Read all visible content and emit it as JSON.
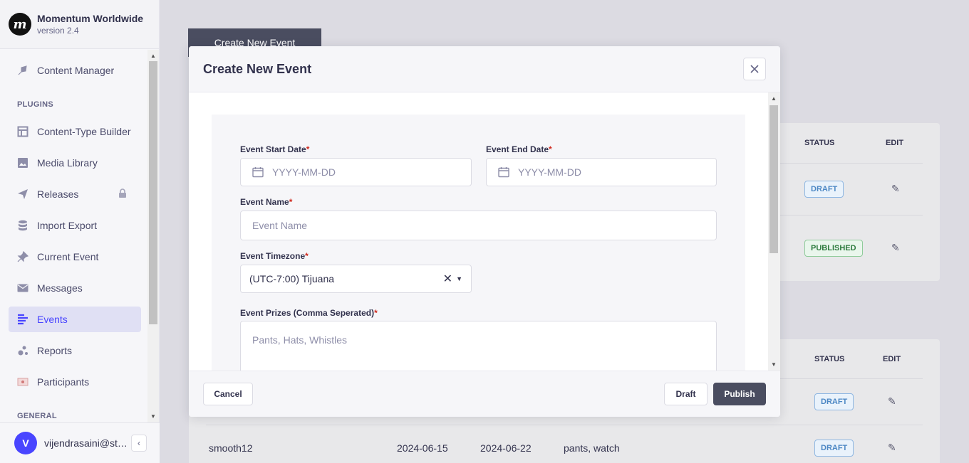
{
  "sidebar": {
    "brand_name": "Momentum Worldwide",
    "brand_version": "version 2.4",
    "items": [
      {
        "label": "Content Manager",
        "icon": "feather-icon"
      },
      {
        "label": "Content-Type Builder",
        "icon": "layout-icon"
      },
      {
        "label": "Media Library",
        "icon": "image-icon"
      },
      {
        "label": "Releases",
        "icon": "paper-plane-icon"
      },
      {
        "label": "Import Export",
        "icon": "database-icon"
      },
      {
        "label": "Current Event",
        "icon": "pin-icon"
      },
      {
        "label": "Messages",
        "icon": "envelope-icon"
      },
      {
        "label": "Events",
        "icon": "list-icon"
      },
      {
        "label": "Reports",
        "icon": "chart-dots-icon"
      },
      {
        "label": "Participants",
        "icon": "badge-icon"
      }
    ],
    "section_plugins": "PLUGINS",
    "section_general": "GENERAL",
    "user_initial": "V",
    "user_email": "vijendrasaini@stackfusion.io"
  },
  "background": {
    "create_button": "Create New Event",
    "table1": {
      "headers": [
        "STATUS",
        "EDIT"
      ],
      "rows": [
        {
          "status": "DRAFT"
        },
        {
          "status": "PUBLISHED"
        }
      ]
    },
    "table2": {
      "headers": [
        "STATUS",
        "EDIT"
      ],
      "rows": [
        {
          "status": "DRAFT"
        },
        {
          "name": "smooth12",
          "start": "2024-06-15",
          "end": "2024-06-22",
          "prizes": "pants, watch",
          "status": "DRAFT"
        }
      ]
    }
  },
  "modal": {
    "title": "Create New Event",
    "fields": {
      "start_date": {
        "label": "Event Start Date",
        "placeholder": "YYYY-MM-DD"
      },
      "end_date": {
        "label": "Event End Date",
        "placeholder": "YYYY-MM-DD"
      },
      "name": {
        "label": "Event Name",
        "placeholder": "Event Name"
      },
      "timezone": {
        "label": "Event Timezone",
        "value": "(UTC-7:00) Tijuana"
      },
      "prizes": {
        "label": "Event Prizes (Comma Seperated)",
        "placeholder": "Pants, Hats, Whistles"
      }
    },
    "required_mark": "*",
    "cancel_label": "Cancel",
    "draft_label": "Draft",
    "publish_label": "Publish"
  }
}
